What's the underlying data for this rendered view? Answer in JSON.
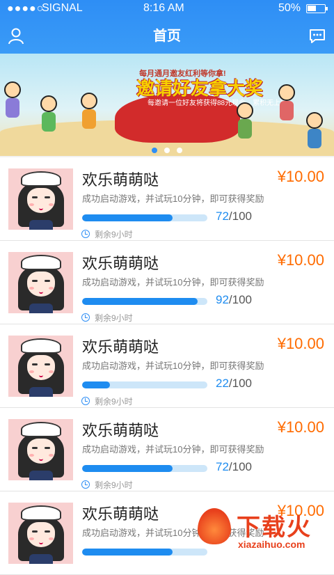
{
  "status_bar": {
    "signal_dots": "●●●●○",
    "carrier": "SIGNAL",
    "time": "8:16  AM",
    "battery": "50%",
    "battery_level": 0.5
  },
  "nav": {
    "title": "首页",
    "left_icon": "user-icon",
    "right_icon": "chat-icon"
  },
  "banner": {
    "line1": "每月通月邀友红利等你拿!",
    "main": "邀请好友拿大奖",
    "line2": "每邀请一位好友将获得88元现金，累积无上限!",
    "pages": 3,
    "active_page": 0
  },
  "cards": [
    {
      "title": "欢乐萌萌哒",
      "price": "¥10.00",
      "desc": "成功启动游戏，并试玩10分钟，即可获得奖励",
      "done": "72",
      "total": "/100",
      "progress": 0.72,
      "remaining": "剩余9小时"
    },
    {
      "title": "欢乐萌萌哒",
      "price": "¥10.00",
      "desc": "成功启动游戏，并试玩10分钟，即可获得奖励",
      "done": "92",
      "total": "/100",
      "progress": 0.92,
      "remaining": "剩余9小时"
    },
    {
      "title": "欢乐萌萌哒",
      "price": "¥10.00",
      "desc": "成功启动游戏，并试玩10分钟，即可获得奖励",
      "done": "22",
      "total": "/100",
      "progress": 0.22,
      "remaining": "剩余9小时"
    },
    {
      "title": "欢乐萌萌哒",
      "price": "¥10.00",
      "desc": "成功启动游戏，并试玩10分钟，即可获得奖励",
      "done": "72",
      "total": "/100",
      "progress": 0.72,
      "remaining": "剩余9小时"
    },
    {
      "title": "欢乐萌萌哒",
      "price": "¥10.00",
      "desc": "成功启动游戏，并试玩10分钟，即可获得奖励",
      "done": "",
      "total": "",
      "progress": 0.72,
      "remaining": ""
    }
  ],
  "watermark": {
    "text": "下载火",
    "sub": "xiazaihuo.com"
  },
  "colors": {
    "primary": "#2e8ef5",
    "price": "#ff6b00",
    "progress": "#1e8cf0"
  }
}
